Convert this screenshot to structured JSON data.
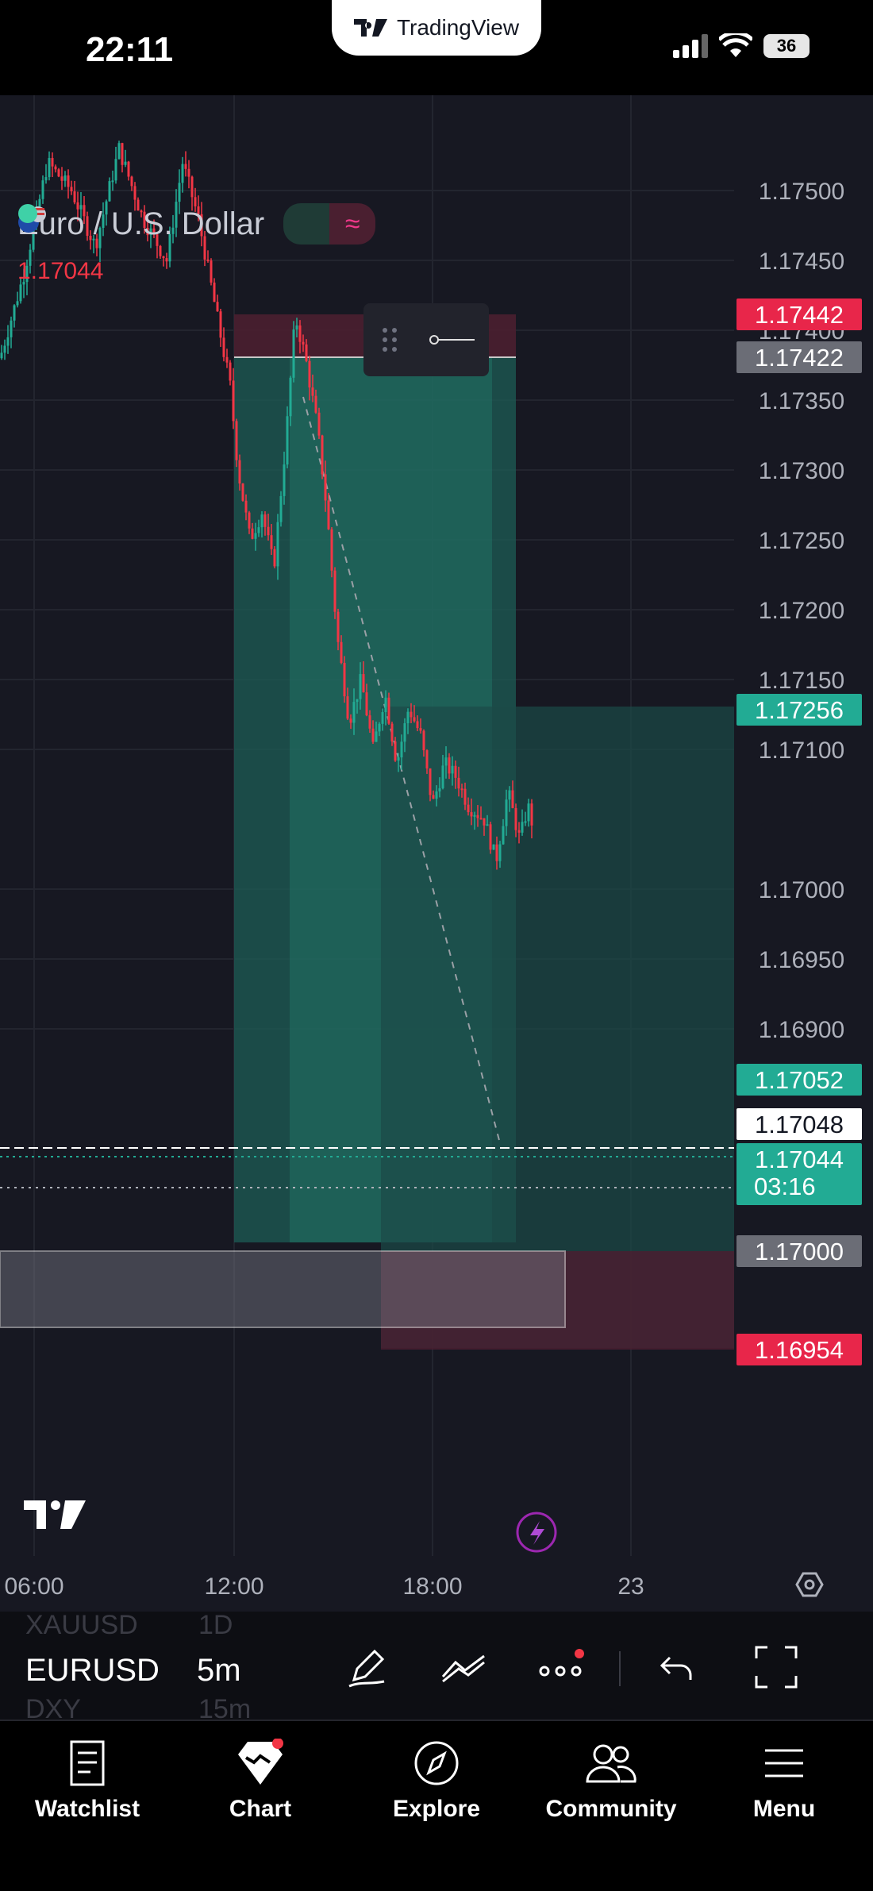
{
  "status": {
    "time": "22:11",
    "brand": "TradingView",
    "battery": "36"
  },
  "chart": {
    "symbol_name": "Euro / U.S. Dollar",
    "last_price": "1.17044",
    "price_axis": [
      "1.17500",
      "1.17450",
      "1.17400",
      "1.17350",
      "1.17300",
      "1.17250",
      "1.17200",
      "1.17150",
      "1.17100",
      "1.17000",
      "1.16950",
      "1.16900"
    ],
    "time_axis": [
      "06:00",
      "12:00",
      "18:00",
      "23"
    ],
    "labels": [
      {
        "text": "1.17442",
        "color": "#e8264a"
      },
      {
        "text": "1.17422",
        "color": "#6b6d76"
      },
      {
        "text": "1.17256",
        "color": "#22ab94"
      },
      {
        "text": "1.17052",
        "color": "#22ab94"
      },
      {
        "text": "1.17048",
        "color": "#ffffff"
      },
      {
        "text": "1.17044",
        "color": "#22ab94"
      },
      {
        "text": "03:16",
        "color": "#22ab94"
      },
      {
        "text": "1.17000",
        "color": "#6b6d76"
      },
      {
        "text": "1.16954",
        "color": "#e8264a"
      }
    ],
    "colors": {
      "up": "#22ab94",
      "down": "#f23645",
      "bg": "#171822"
    }
  },
  "toolbar": {
    "symbol": "EURUSD",
    "interval": "5m",
    "ghost_symbol_top": "XAUUSD",
    "ghost_interval_top": "1D",
    "ghost_symbol_bottom": "DXY",
    "ghost_interval_bottom": "15m"
  },
  "tabs": [
    {
      "label": "Watchlist",
      "icon": "book-icon"
    },
    {
      "label": "Chart",
      "icon": "chart-icon"
    },
    {
      "label": "Explore",
      "icon": "compass-icon"
    },
    {
      "label": "Community",
      "icon": "people-icon"
    },
    {
      "label": "Menu",
      "icon": "menu-icon"
    }
  ]
}
